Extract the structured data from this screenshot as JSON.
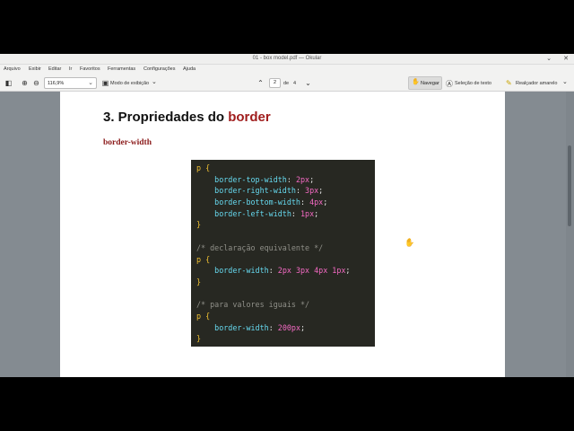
{
  "window": {
    "title": "01 - box model.pdf — Okular",
    "minimize_icon": "chevron-down-icon",
    "close_icon": "close-icon"
  },
  "menu": [
    "Arquivo",
    "Exibir",
    "Editar",
    "Ir",
    "Favoritos",
    "Ferramentas",
    "Configurações",
    "Ajuda"
  ],
  "toolbar": {
    "zoom": "116,9%",
    "view_mode": "Modo de exibição",
    "page_current": "2",
    "page_of": "de",
    "page_total": "4",
    "navigate": "Navegar",
    "text_select": "Seleção de texto",
    "highlighter": "Realçador amarelo"
  },
  "document": {
    "heading_prefix": "3. Propriedades do ",
    "heading_highlight": "border",
    "subheading": "border-width",
    "code": [
      [
        {
          "c": "sel",
          "t": "p "
        },
        {
          "c": "brace",
          "t": "{"
        }
      ],
      [
        {
          "c": "pl",
          "t": "    "
        },
        {
          "c": "prop",
          "t": "border-top-width"
        },
        {
          "c": "pl",
          "t": ": "
        },
        {
          "c": "num",
          "t": "2px"
        },
        {
          "c": "pl",
          "t": ";"
        }
      ],
      [
        {
          "c": "pl",
          "t": "    "
        },
        {
          "c": "prop",
          "t": "border-right-width"
        },
        {
          "c": "pl",
          "t": ": "
        },
        {
          "c": "num",
          "t": "3px"
        },
        {
          "c": "pl",
          "t": ";"
        }
      ],
      [
        {
          "c": "pl",
          "t": "    "
        },
        {
          "c": "prop",
          "t": "border-bottom-width"
        },
        {
          "c": "pl",
          "t": ": "
        },
        {
          "c": "num",
          "t": "4px"
        },
        {
          "c": "pl",
          "t": ";"
        }
      ],
      [
        {
          "c": "pl",
          "t": "    "
        },
        {
          "c": "prop",
          "t": "border-left-width"
        },
        {
          "c": "pl",
          "t": ": "
        },
        {
          "c": "num",
          "t": "1px"
        },
        {
          "c": "pl",
          "t": ";"
        }
      ],
      [
        {
          "c": "brace",
          "t": "}"
        }
      ],
      [
        {
          "c": "pl",
          "t": ""
        }
      ],
      [
        {
          "c": "cm",
          "t": "/* declaração equivalente */"
        }
      ],
      [
        {
          "c": "sel",
          "t": "p "
        },
        {
          "c": "brace",
          "t": "{"
        }
      ],
      [
        {
          "c": "pl",
          "t": "    "
        },
        {
          "c": "prop",
          "t": "border-width"
        },
        {
          "c": "pl",
          "t": ": "
        },
        {
          "c": "num",
          "t": "2px 3px 4px 1px"
        },
        {
          "c": "pl",
          "t": ";"
        }
      ],
      [
        {
          "c": "brace",
          "t": "}"
        }
      ],
      [
        {
          "c": "pl",
          "t": ""
        }
      ],
      [
        {
          "c": "cm",
          "t": "/* para valores iguais */"
        }
      ],
      [
        {
          "c": "sel",
          "t": "p "
        },
        {
          "c": "brace",
          "t": "{"
        }
      ],
      [
        {
          "c": "pl",
          "t": "    "
        },
        {
          "c": "prop",
          "t": "border-width"
        },
        {
          "c": "pl",
          "t": ": "
        },
        {
          "c": "num",
          "t": "200px"
        },
        {
          "c": "pl",
          "t": ";"
        }
      ],
      [
        {
          "c": "brace",
          "t": "}"
        }
      ]
    ]
  },
  "colors": {
    "heading_highlight": "#a01d1d",
    "code_background": "#272822",
    "code_property": "#66d9ef",
    "code_number": "#f56ac4",
    "code_selector": "#f1c232",
    "code_comment": "#8f8f88"
  }
}
